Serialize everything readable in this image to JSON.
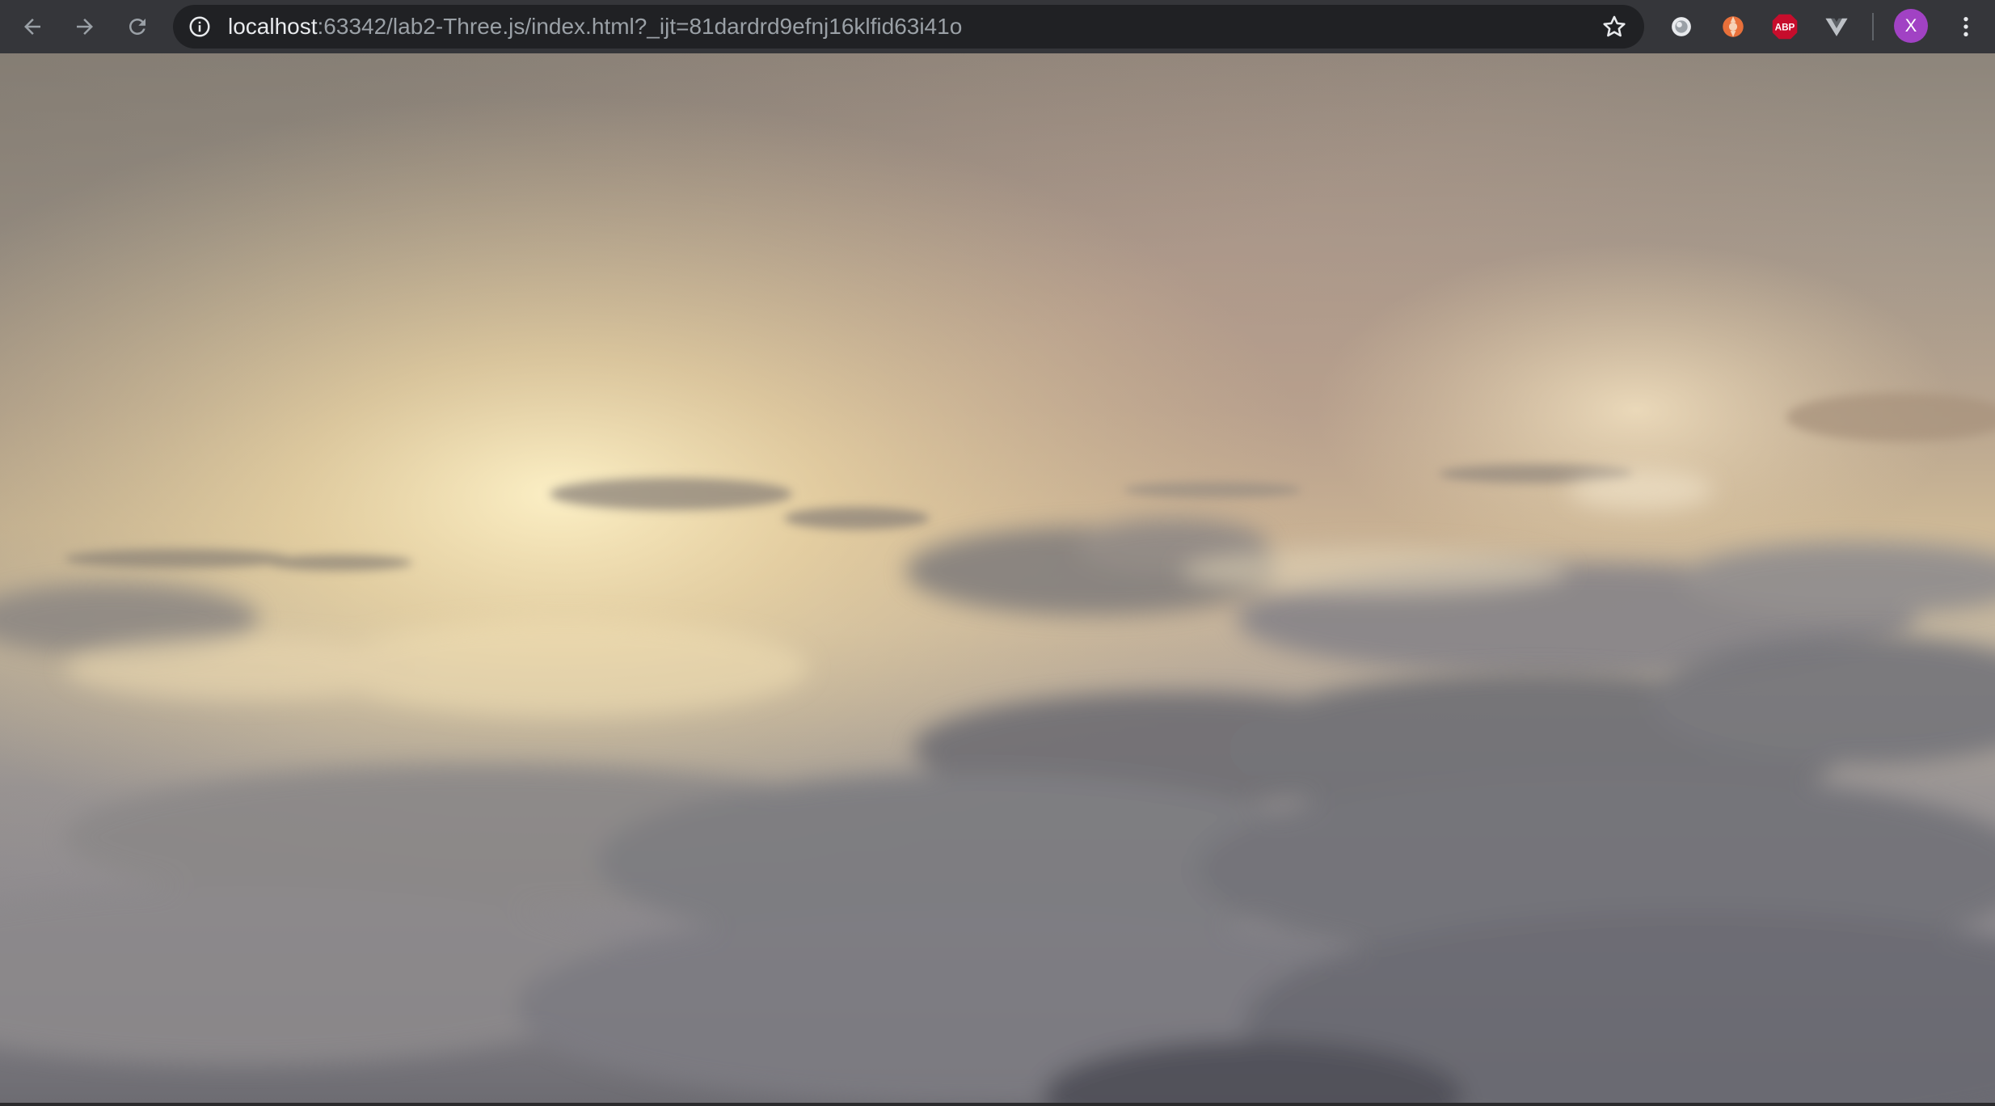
{
  "browser": {
    "url_host": "localhost",
    "url_rest": ":63342/lab2-Three.js/index.html?_ijt=81dardrd9efnj16klfid63i41o",
    "profile_initial": "X",
    "extensions": [
      {
        "icon": "record-extension-icon"
      },
      {
        "icon": "orange-extension-icon"
      },
      {
        "icon": "adblock-plus-icon",
        "label": "ABP"
      },
      {
        "icon": "vue-devtools-icon"
      }
    ],
    "colors": {
      "toolbar": "#35363a",
      "omnibox": "#202124",
      "url_host": "#e8eaed",
      "url_rest": "#9aa0a6",
      "avatar": "#a142c4",
      "abp": "#c70d2c"
    }
  },
  "scene": {
    "description_icon": "cloud-skybox-canvas",
    "colors": {
      "sky_top": "#8f8577",
      "sky_mid": "#b9a88f",
      "sun_glow": "#f4e2b0",
      "clouds": "#7d7b80",
      "clouds_dark": "#55565d"
    }
  }
}
